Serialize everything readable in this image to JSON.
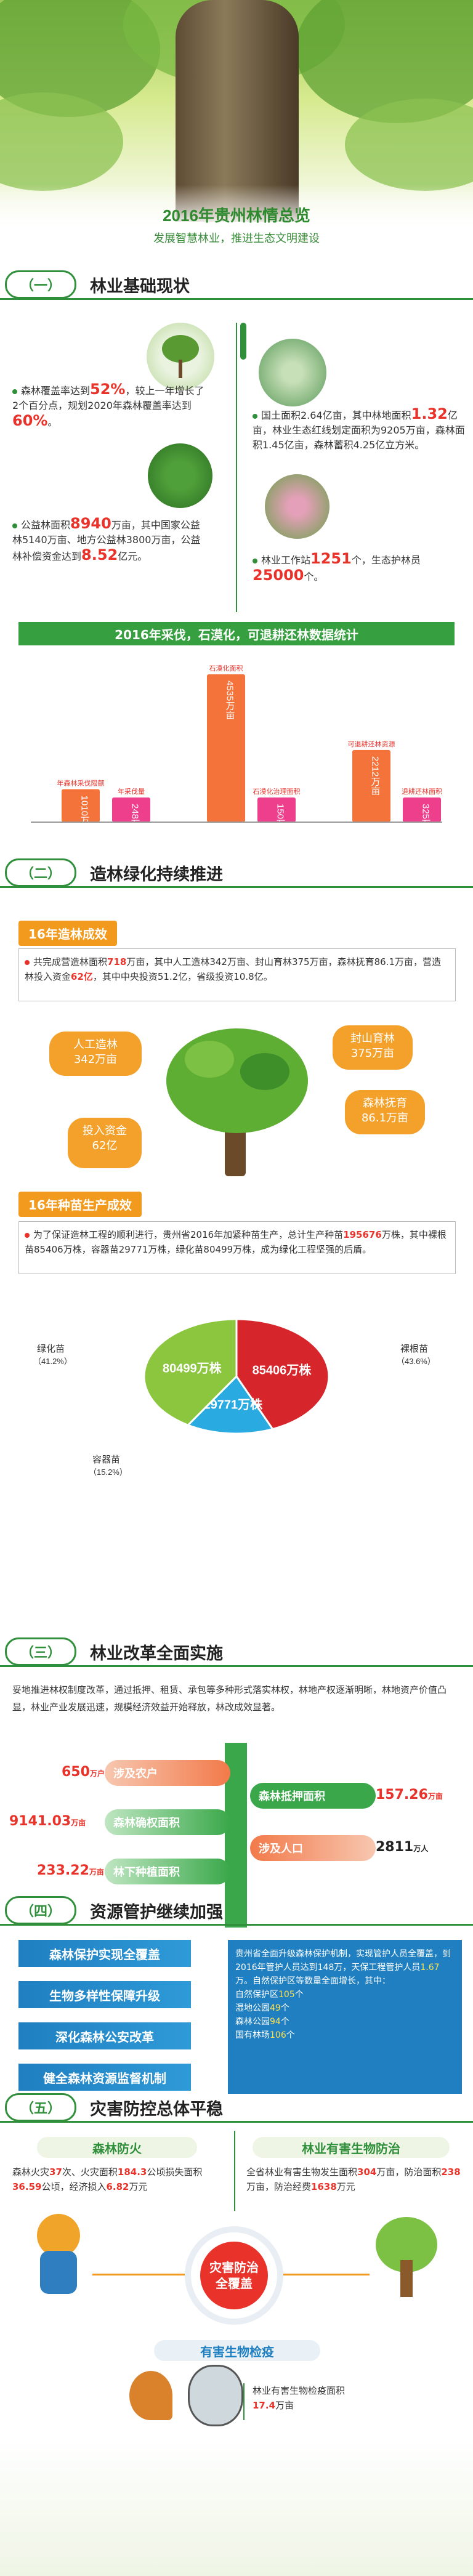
{
  "header": {
    "title": "2016年贵州林情总览",
    "subtitle": "发展智慧林业，推进生态文明建设"
  },
  "sec1": {
    "num": "（一）",
    "title": "林业基础现状",
    "p1": [
      "森林覆盖率达到",
      "52%",
      "，较上一年增长了2个百分点，规划2020年森林覆盖率达到",
      "60%",
      "。"
    ],
    "p2": [
      "国土面积2.64亿亩，其中林地面积",
      "1.32",
      "亿亩，林业生态红线划定面积为9205万亩，森林面积1.45亿亩，森林蓄积4.25亿立方米。"
    ],
    "p3": [
      "公益林面积",
      "8940",
      "万亩，其中国家公益林5140万亩、地方公益林3800万亩，公益林补偿资金达到",
      "8.52",
      "亿元。"
    ],
    "p4": [
      "林业工作站",
      "1251",
      "个，生态护林员",
      "25000",
      "个。"
    ],
    "chart_title": "2016年采伐，石漠化，可退耕还林数据统计"
  },
  "chart_data": {
    "type": "bar",
    "title": "2016年采伐，石漠化，可退耕还林数据统计",
    "categories": [
      "年森林采伐限额",
      "年采伐量",
      "石漠化面积",
      "石漠化治理面积",
      "可退耕还林资源",
      "退耕还林面积"
    ],
    "values": [
      1010,
      248,
      4535,
      150,
      2212,
      325
    ],
    "value_labels": [
      "1010万m3",
      "248万m3",
      "4535万亩",
      "150万亩",
      "2212万亩",
      "325万亩"
    ],
    "colors": [
      "#f4733a",
      "#ee3f8c",
      "#f4733a",
      "#ee3f8c",
      "#f4733a",
      "#ee3f8c"
    ],
    "ylim": [
      0,
      4535
    ]
  },
  "sec2": {
    "num": "（二）",
    "title": "造林绿化持续推进",
    "tag1": "16年造林成效",
    "p1": [
      "共完成营造林面积",
      "718",
      "万亩，其中人工造林342万亩、封山育林375万亩，森林抚育86.1万亩，营造林投入资金",
      "62亿",
      "，其中中央投资51.2亿，省级投资10.8亿。"
    ],
    "clouds": [
      {
        "label": "人工造林",
        "value": "342万亩"
      },
      {
        "label": "投入资金",
        "value": "62亿"
      },
      {
        "label": "封山育林",
        "value": "375万亩"
      },
      {
        "label": "森林抚育",
        "value": "86.1万亩"
      }
    ],
    "tag2": "16年种苗生产成效",
    "p2": [
      "为了保证造林工程的顺利进行，贵州省2016年加紧种苗生产，总计生产种苗",
      "195676",
      "万株，其中裸根苗85406万株，容器苗29771万株，绿化苗80499万株，成为绿化工程坚强的后盾。"
    ],
    "pie": [
      {
        "name": "绿化苗",
        "pct": "（41.2%）",
        "value": "80499万株",
        "fraction": 0.412,
        "color": "#8cc63f"
      },
      {
        "name": "裸根苗",
        "pct": "（43.6%）",
        "value": "85406万株",
        "fraction": 0.436,
        "color": "#d7262b"
      },
      {
        "name": "容器苗",
        "pct": "（15.2%）",
        "value": "29771万株",
        "fraction": 0.152,
        "color": "#29aae1"
      }
    ]
  },
  "sec3": {
    "num": "（三）",
    "title": "林业改革全面实施",
    "p1": "妥地推进林权制度改革，通过抵押、租赁、承包等多种形式落实林权，林地产权逐渐明晰，林地资产价值凸显，林业产业发展迅速，规模经济效益开始释放，林改成效显著。",
    "left": [
      {
        "value": "650",
        "unit": "万户",
        "label": "涉及农户"
      },
      {
        "value": "9141.03",
        "unit": "万亩",
        "label": "森林确权面积"
      },
      {
        "value": "233.22",
        "unit": "万亩",
        "label": "林下种植面积"
      }
    ],
    "right": [
      {
        "value": "157.26",
        "unit": "万亩",
        "label": "森林抵押面积"
      },
      {
        "value": "2811",
        "unit": "万人",
        "label": "涉及人口"
      }
    ]
  },
  "sec4": {
    "num": "（四）",
    "title": "资源管护继续加强",
    "items": [
      "森林保护实现全覆盖",
      "生物多样性保障升级",
      "深化森林公安改革",
      "健全森林资源监督机制"
    ],
    "box": [
      "贵州省全面升级森林保护机制，实现管护人员全覆盖，到2016年管护人员达到148万，天保工程管护人员",
      "1.67",
      "万。自然保护区等数量全面增长，其中：",
      "自然保护区",
      "105",
      "个",
      "湿地公园",
      "49",
      "个",
      "森林公园",
      "94",
      "个",
      "国有林场",
      "106",
      "个"
    ]
  },
  "sec5": {
    "num": "（五）",
    "title": "灾害防控总体平稳",
    "fire_title": "森林防火",
    "fire_text": [
      "森林火灾",
      "37",
      "次、火灾面积",
      "184.3",
      "公顷损失面积",
      "36.59",
      "公顷，经济损入",
      "6.82",
      "万元"
    ],
    "pest_title": "林业有害生物防治",
    "pest_text": [
      "全省林业有害生物发生面积",
      "304",
      "万亩，防治面积",
      "238",
      "万亩，防治经费",
      "1638",
      "万元"
    ],
    "center": "灾害防治全覆盖",
    "quarantine_title": "有害生物检疫",
    "quarantine_text": [
      "林业有害生物检疫面积",
      "17.4",
      "万亩"
    ]
  }
}
